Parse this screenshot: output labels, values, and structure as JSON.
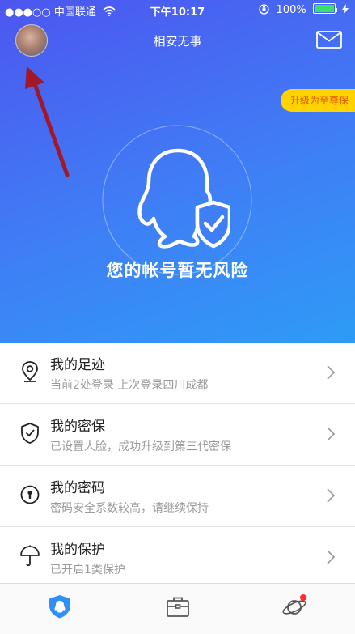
{
  "status_bar": {
    "signal": "●●●○○",
    "carrier": "中国联通",
    "wifi_icon": "wifi-icon",
    "time": "下午10:17",
    "battery": "100%"
  },
  "header": {
    "title": "相安无事",
    "mail_icon": "mail-icon"
  },
  "hero": {
    "upgrade_badge": "升级为至尊保",
    "status_text": "您的帐号暂无风险",
    "colors": {
      "gradient_start": "#4d56f0",
      "gradient_end": "#2e9bf6",
      "badge": "#ffd200"
    }
  },
  "menu": [
    {
      "label": "我的足迹",
      "sub": "当前2处登录 上次登录四川成都",
      "icon": "location-pin-icon"
    },
    {
      "label": "我的密保",
      "sub": "已设置人脸，成功升级到第三代密保",
      "icon": "shield-check-icon"
    },
    {
      "label": "我的密码",
      "sub": "密码安全系数较高，请继续保持",
      "icon": "keyhole-icon"
    },
    {
      "label": "我的保护",
      "sub": "已开启1类保护",
      "icon": "umbrella-icon"
    }
  ],
  "tabbar": [
    {
      "name": "security",
      "icon": "penguin-shield-icon",
      "active": true
    },
    {
      "name": "tools",
      "icon": "briefcase-icon",
      "active": false
    },
    {
      "name": "discover",
      "icon": "planet-icon",
      "active": false,
      "badge_dot": true
    }
  ]
}
